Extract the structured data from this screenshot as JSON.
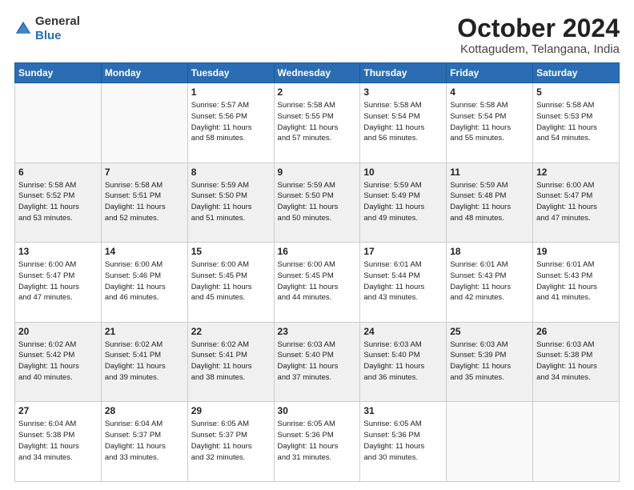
{
  "header": {
    "logo_general": "General",
    "logo_blue": "Blue",
    "month_title": "October 2024",
    "location": "Kottagudem, Telangana, India"
  },
  "weekdays": [
    "Sunday",
    "Monday",
    "Tuesday",
    "Wednesday",
    "Thursday",
    "Friday",
    "Saturday"
  ],
  "weeks": [
    [
      {
        "day": "",
        "info": ""
      },
      {
        "day": "",
        "info": ""
      },
      {
        "day": "1",
        "info": "Sunrise: 5:57 AM\nSunset: 5:56 PM\nDaylight: 11 hours\nand 58 minutes."
      },
      {
        "day": "2",
        "info": "Sunrise: 5:58 AM\nSunset: 5:55 PM\nDaylight: 11 hours\nand 57 minutes."
      },
      {
        "day": "3",
        "info": "Sunrise: 5:58 AM\nSunset: 5:54 PM\nDaylight: 11 hours\nand 56 minutes."
      },
      {
        "day": "4",
        "info": "Sunrise: 5:58 AM\nSunset: 5:54 PM\nDaylight: 11 hours\nand 55 minutes."
      },
      {
        "day": "5",
        "info": "Sunrise: 5:58 AM\nSunset: 5:53 PM\nDaylight: 11 hours\nand 54 minutes."
      }
    ],
    [
      {
        "day": "6",
        "info": "Sunrise: 5:58 AM\nSunset: 5:52 PM\nDaylight: 11 hours\nand 53 minutes."
      },
      {
        "day": "7",
        "info": "Sunrise: 5:58 AM\nSunset: 5:51 PM\nDaylight: 11 hours\nand 52 minutes."
      },
      {
        "day": "8",
        "info": "Sunrise: 5:59 AM\nSunset: 5:50 PM\nDaylight: 11 hours\nand 51 minutes."
      },
      {
        "day": "9",
        "info": "Sunrise: 5:59 AM\nSunset: 5:50 PM\nDaylight: 11 hours\nand 50 minutes."
      },
      {
        "day": "10",
        "info": "Sunrise: 5:59 AM\nSunset: 5:49 PM\nDaylight: 11 hours\nand 49 minutes."
      },
      {
        "day": "11",
        "info": "Sunrise: 5:59 AM\nSunset: 5:48 PM\nDaylight: 11 hours\nand 48 minutes."
      },
      {
        "day": "12",
        "info": "Sunrise: 6:00 AM\nSunset: 5:47 PM\nDaylight: 11 hours\nand 47 minutes."
      }
    ],
    [
      {
        "day": "13",
        "info": "Sunrise: 6:00 AM\nSunset: 5:47 PM\nDaylight: 11 hours\nand 47 minutes."
      },
      {
        "day": "14",
        "info": "Sunrise: 6:00 AM\nSunset: 5:46 PM\nDaylight: 11 hours\nand 46 minutes."
      },
      {
        "day": "15",
        "info": "Sunrise: 6:00 AM\nSunset: 5:45 PM\nDaylight: 11 hours\nand 45 minutes."
      },
      {
        "day": "16",
        "info": "Sunrise: 6:00 AM\nSunset: 5:45 PM\nDaylight: 11 hours\nand 44 minutes."
      },
      {
        "day": "17",
        "info": "Sunrise: 6:01 AM\nSunset: 5:44 PM\nDaylight: 11 hours\nand 43 minutes."
      },
      {
        "day": "18",
        "info": "Sunrise: 6:01 AM\nSunset: 5:43 PM\nDaylight: 11 hours\nand 42 minutes."
      },
      {
        "day": "19",
        "info": "Sunrise: 6:01 AM\nSunset: 5:43 PM\nDaylight: 11 hours\nand 41 minutes."
      }
    ],
    [
      {
        "day": "20",
        "info": "Sunrise: 6:02 AM\nSunset: 5:42 PM\nDaylight: 11 hours\nand 40 minutes."
      },
      {
        "day": "21",
        "info": "Sunrise: 6:02 AM\nSunset: 5:41 PM\nDaylight: 11 hours\nand 39 minutes."
      },
      {
        "day": "22",
        "info": "Sunrise: 6:02 AM\nSunset: 5:41 PM\nDaylight: 11 hours\nand 38 minutes."
      },
      {
        "day": "23",
        "info": "Sunrise: 6:03 AM\nSunset: 5:40 PM\nDaylight: 11 hours\nand 37 minutes."
      },
      {
        "day": "24",
        "info": "Sunrise: 6:03 AM\nSunset: 5:40 PM\nDaylight: 11 hours\nand 36 minutes."
      },
      {
        "day": "25",
        "info": "Sunrise: 6:03 AM\nSunset: 5:39 PM\nDaylight: 11 hours\nand 35 minutes."
      },
      {
        "day": "26",
        "info": "Sunrise: 6:03 AM\nSunset: 5:38 PM\nDaylight: 11 hours\nand 34 minutes."
      }
    ],
    [
      {
        "day": "27",
        "info": "Sunrise: 6:04 AM\nSunset: 5:38 PM\nDaylight: 11 hours\nand 34 minutes."
      },
      {
        "day": "28",
        "info": "Sunrise: 6:04 AM\nSunset: 5:37 PM\nDaylight: 11 hours\nand 33 minutes."
      },
      {
        "day": "29",
        "info": "Sunrise: 6:05 AM\nSunset: 5:37 PM\nDaylight: 11 hours\nand 32 minutes."
      },
      {
        "day": "30",
        "info": "Sunrise: 6:05 AM\nSunset: 5:36 PM\nDaylight: 11 hours\nand 31 minutes."
      },
      {
        "day": "31",
        "info": "Sunrise: 6:05 AM\nSunset: 5:36 PM\nDaylight: 11 hours\nand 30 minutes."
      },
      {
        "day": "",
        "info": ""
      },
      {
        "day": "",
        "info": ""
      }
    ]
  ]
}
